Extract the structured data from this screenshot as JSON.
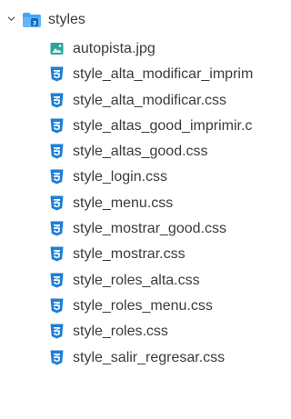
{
  "explorer": {
    "folder": {
      "name": "styles",
      "expanded": true,
      "chevron_icon": "chevron-down-icon",
      "icon": "folder-styles-icon",
      "icon_color": "#42a5f5"
    },
    "files": [
      {
        "name": "autopista.jpg",
        "icon": "image-file-icon"
      },
      {
        "name": "style_alta_modificar_imprim",
        "icon": "css-file-icon"
      },
      {
        "name": "style_alta_modificar.css",
        "icon": "css-file-icon"
      },
      {
        "name": "style_altas_good_imprimir.c",
        "icon": "css-file-icon"
      },
      {
        "name": "style_altas_good.css",
        "icon": "css-file-icon"
      },
      {
        "name": "style_login.css",
        "icon": "css-file-icon"
      },
      {
        "name": "style_menu.css",
        "icon": "css-file-icon"
      },
      {
        "name": "style_mostrar_good.css",
        "icon": "css-file-icon"
      },
      {
        "name": "style_mostrar.css",
        "icon": "css-file-icon"
      },
      {
        "name": "style_roles_alta.css",
        "icon": "css-file-icon"
      },
      {
        "name": "style_roles_menu.css",
        "icon": "css-file-icon"
      },
      {
        "name": "style_roles.css",
        "icon": "css-file-icon"
      },
      {
        "name": "style_salir_regresar.css",
        "icon": "css-file-icon"
      }
    ],
    "colors": {
      "css_icon": "#1e7fd6",
      "image_icon": "#26a69a",
      "text": "#3b3b3b"
    }
  }
}
